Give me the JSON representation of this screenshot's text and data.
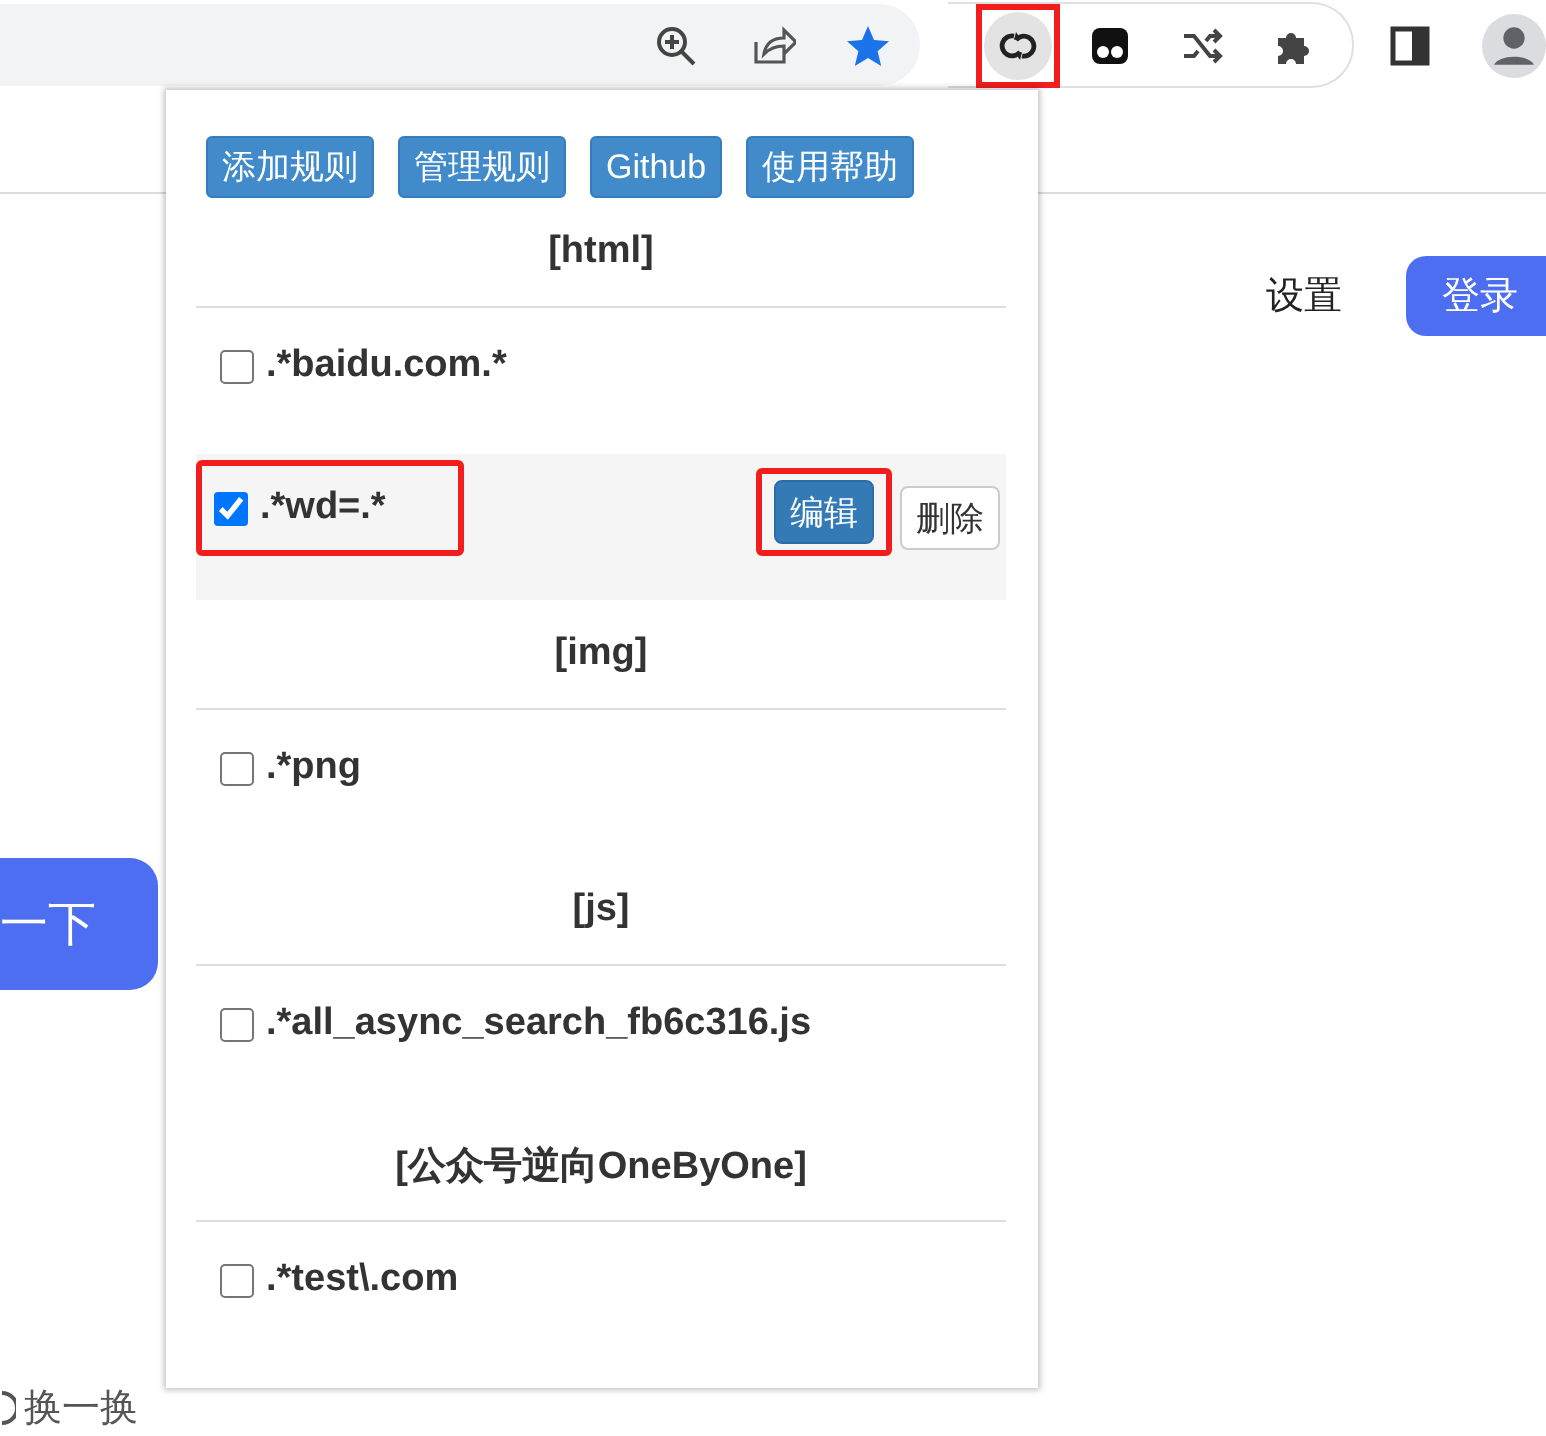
{
  "toolbar": {
    "address_actions": [
      {
        "kind": "zoom"
      },
      {
        "kind": "share"
      },
      {
        "kind": "star"
      }
    ],
    "extensions": [
      {
        "kind": "loop",
        "highlighted": true
      },
      {
        "kind": "mask",
        "highlighted": false
      },
      {
        "kind": "shuffle",
        "highlighted": false
      },
      {
        "kind": "puzzle",
        "highlighted": false
      }
    ],
    "profile_actions": [
      {
        "kind": "sidepanel"
      },
      {
        "kind": "avatar"
      }
    ]
  },
  "page": {
    "settings_link": "设置",
    "login_button": "登录",
    "search_button": "一下",
    "refresh_link": "换一换"
  },
  "popup": {
    "buttons": [
      "添加规则",
      "管理规则",
      "Github",
      "使用帮助"
    ],
    "groups": [
      {
        "title": "[html]",
        "rules": [
          {
            "pattern": ".*baidu.com.*",
            "checked": false,
            "hovered": false,
            "highlighted": false
          },
          {
            "pattern": ".*wd=.*",
            "checked": true,
            "hovered": true,
            "highlighted": true,
            "actions": [
              {
                "label": "编辑",
                "kind": "primary",
                "highlighted": true
              },
              {
                "label": "删除",
                "kind": "default",
                "highlighted": false
              }
            ]
          }
        ]
      },
      {
        "title": "[img]",
        "rules": [
          {
            "pattern": ".*png",
            "checked": false,
            "hovered": false,
            "highlighted": false
          }
        ]
      },
      {
        "title": "[js]",
        "rules": [
          {
            "pattern": ".*all_async_search_fb6c316.js",
            "checked": false,
            "hovered": false,
            "highlighted": false
          }
        ]
      },
      {
        "title": "[公众号逆向OneByOne]",
        "rules": [
          {
            "pattern": ".*test\\.com",
            "checked": false,
            "hovered": false,
            "highlighted": false
          }
        ]
      }
    ]
  }
}
